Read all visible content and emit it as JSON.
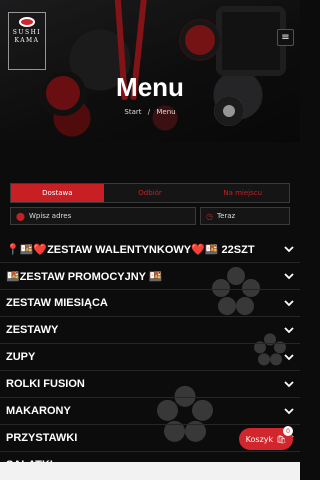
{
  "brand": {
    "logo_text": "SUSHI KAMA"
  },
  "hero": {
    "title": "Menu",
    "breadcrumb": [
      "Start",
      "/",
      "Menu"
    ]
  },
  "order": {
    "tabs": [
      "Dostawa",
      "Odbiór",
      "Na miejscu"
    ],
    "active_tab": "Dostawa",
    "address_placeholder": "Wpisz adres",
    "time_value": "Teraz"
  },
  "categories": [
    "📍🍱❤️ZESTAW WALENTYNKOWY❤️🍱 22SZT",
    "🍱ZESTAW PROMOCYJNY 🍱",
    "ZESTAW MIESIĄCA",
    "ZESTAWY",
    "ZUPY",
    "ROLKI FUSION",
    "MAKARONY",
    "PRZYSTAWKI",
    "SAŁATKI"
  ],
  "cart": {
    "label": "Koszyk",
    "count": "0"
  },
  "colors": {
    "accent": "#c81f24",
    "background": "#0c0c0d"
  },
  "icons": {
    "menu": "hamburger-icon",
    "address": "map-pin-icon",
    "time": "clock-icon",
    "cart": "shopping-bag-icon",
    "expand": "chevron-down-icon"
  }
}
